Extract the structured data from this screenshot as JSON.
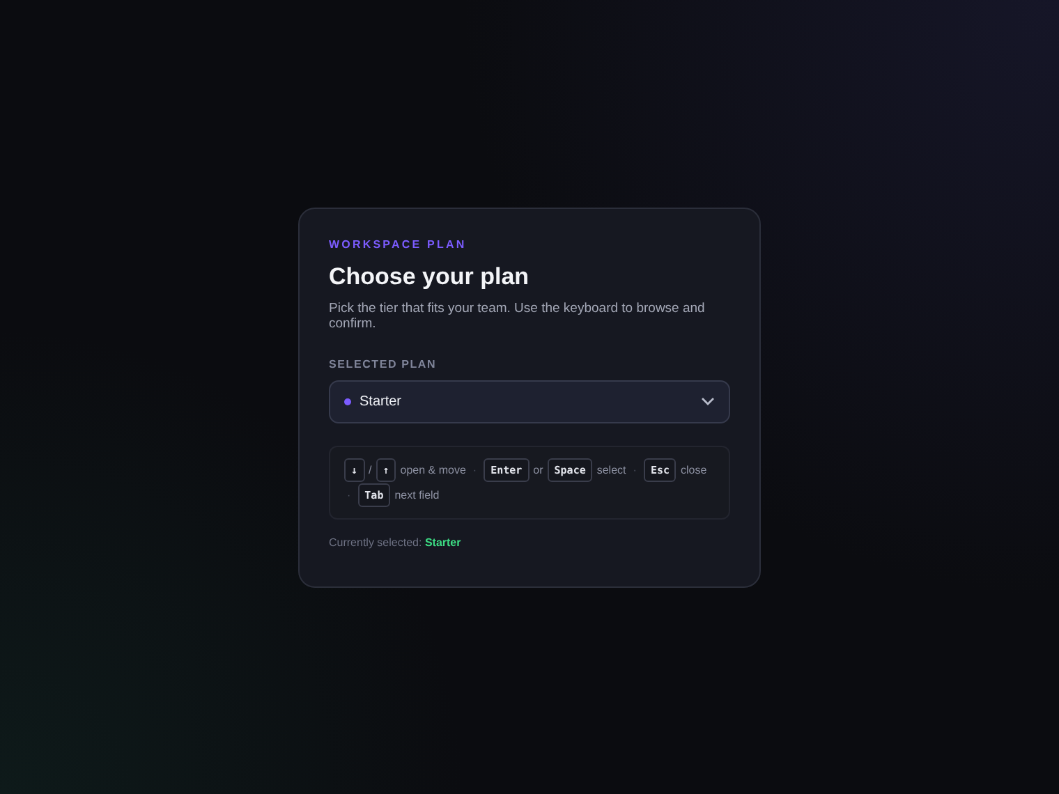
{
  "card": {
    "eyebrow": "WORKSPACE PLAN",
    "title": "Choose your plan",
    "description": "Pick the tier that fits your team. Use the keyboard to browse and confirm.",
    "field_label": "SELECTED PLAN",
    "select": {
      "value": "Starter",
      "color": "#7c5cff"
    },
    "hints": [
      {
        "kind": "key",
        "text": "↓"
      },
      {
        "kind": "text",
        "text": "/"
      },
      {
        "kind": "key",
        "text": "↑"
      },
      {
        "kind": "text",
        "text": "open & move"
      },
      {
        "kind": "sep",
        "text": "·"
      },
      {
        "kind": "key",
        "text": "Enter"
      },
      {
        "kind": "text",
        "text": "or"
      },
      {
        "kind": "key",
        "text": "Space"
      },
      {
        "kind": "text",
        "text": "select"
      },
      {
        "kind": "sep",
        "text": "·"
      },
      {
        "kind": "key",
        "text": "Esc"
      },
      {
        "kind": "text",
        "text": "close"
      },
      {
        "kind": "sep",
        "text": "·"
      },
      {
        "kind": "key",
        "text": "Tab"
      },
      {
        "kind": "text",
        "text": "next field"
      }
    ],
    "status_label": "Currently selected:",
    "status_value": "Starter"
  }
}
